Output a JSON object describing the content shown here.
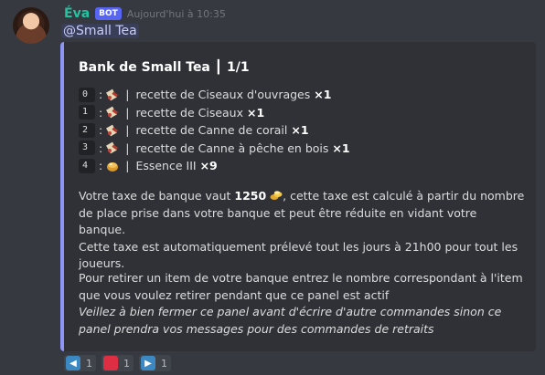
{
  "header": {
    "username": "Éva",
    "badge": "BOT",
    "timestamp": "Aujourd'hui à 10:35"
  },
  "message": {
    "mention": "@Small Tea"
  },
  "embed": {
    "title": "Bank de Small Tea  ┃ 1/1",
    "items": [
      {
        "index": "0",
        "icon": "scroll-icon",
        "label": "recette de Ciseaux d'ouvrages",
        "qty": "×1"
      },
      {
        "index": "1",
        "icon": "scroll-icon",
        "label": "recette de Ciseaux",
        "qty": "×1"
      },
      {
        "index": "2",
        "icon": "scroll-icon",
        "label": "recette de Canne de corail",
        "qty": "×1"
      },
      {
        "index": "3",
        "icon": "scroll-icon",
        "label": "recette de Canne à pêche en bois",
        "qty": "×1"
      },
      {
        "index": "4",
        "icon": "essence-icon",
        "label": "Essence III",
        "qty": "×9"
      }
    ],
    "tax": {
      "prefix": "Votre taxe de banque vaut ",
      "amount": "1250",
      "suffix": ", cette taxe est calculé à partir du nombre de place prise dans votre banque et peut être réduite en vidant votre banque.",
      "line2": "Cette taxe est automatiquement prélevé tout les jours à 21h00 pour tout les joueurs."
    },
    "withdraw": {
      "line1": "Pour retirer un item de votre banque entrez le nombre correspondant à l'item que vous voulez retirer pendant que ce panel est actif",
      "line2": "Veillez à bien fermer ce panel avant d'écrire d'autre commandes sinon ce panel prendra vos messages pour des commandes de retraits"
    }
  },
  "reactions": [
    {
      "icon": "left-arrow-icon",
      "glyph": "◀",
      "count": "1",
      "color": "#3b88c3"
    },
    {
      "icon": "stop-icon",
      "glyph": "",
      "count": "1",
      "color": "#dd2e44"
    },
    {
      "icon": "right-arrow-icon",
      "glyph": "▶",
      "count": "1",
      "color": "#3b88c3"
    }
  ]
}
